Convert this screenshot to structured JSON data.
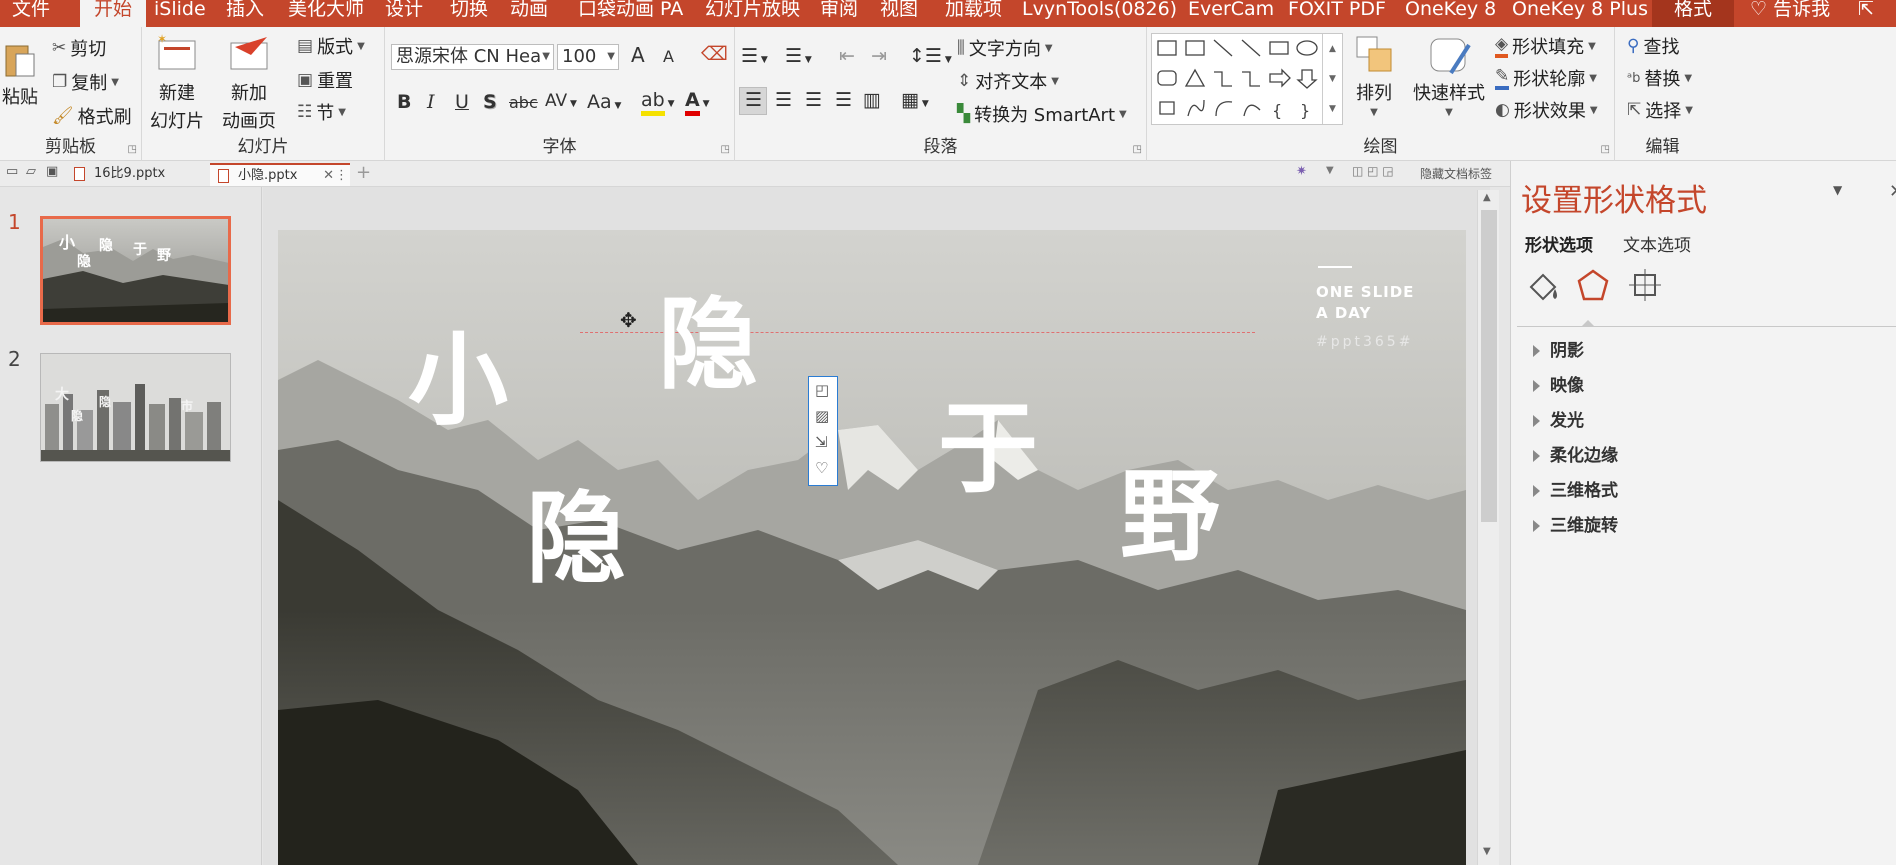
{
  "menu": {
    "tabs": [
      "文件",
      "开始",
      "iSlide",
      "插入",
      "美化大师",
      "设计",
      "切换",
      "动画",
      "口袋动画 PA",
      "幻灯片放映",
      "审阅",
      "视图",
      "加载项",
      "LvynTools(0826)",
      "EverCam",
      "FOXIT PDF",
      "OneKey 8",
      "OneKey 8 Plus",
      "格式",
      "告诉我"
    ],
    "active_tab": "开始"
  },
  "ribbon": {
    "clipboard": {
      "paste": "粘贴",
      "cut": "剪切",
      "copy": "复制",
      "format_painter": "格式刷",
      "label": "剪贴板"
    },
    "slides": {
      "new_slide_l1": "新建",
      "new_slide_l2": "幻灯片",
      "new_anim_l1": "新加",
      "new_anim_l2": "动画页",
      "layout": "版式",
      "reset": "重置",
      "section": "节",
      "label": "幻灯片"
    },
    "font": {
      "family": "思源宋体 CN Hea",
      "size": "100",
      "label": "字体",
      "bold": "B",
      "italic": "I",
      "underline": "U",
      "shadow": "S",
      "strike": "abc",
      "spacing": "AV",
      "case": "Aa",
      "grow": "A",
      "shrink": "A"
    },
    "paragraph": {
      "text_direction": "文字方向",
      "align_text": "对齐文本",
      "convert_smartart": "转换为 SmartArt",
      "label": "段落"
    },
    "drawing": {
      "arrange": "排列",
      "quick_styles": "快速样式",
      "shape_fill": "形状填充",
      "shape_outline": "形状轮廓",
      "shape_effects": "形状效果",
      "label": "绘图"
    },
    "editing": {
      "find": "查找",
      "replace": "替换",
      "select": "选择",
      "label": "编辑"
    }
  },
  "file_tabs": [
    {
      "name": "16比9.pptx",
      "active": false
    },
    {
      "name": "小隐.pptx",
      "active": true
    }
  ],
  "tabbar_right": "隐藏文档标签",
  "slides": [
    {
      "number": "1",
      "selected": true
    },
    {
      "number": "2",
      "selected": false
    }
  ],
  "slide": {
    "chars": {
      "c1": "小",
      "c2": "隐",
      "c3": "隐",
      "c4": "于",
      "c5": "野"
    },
    "header_line1": "ONE SLIDE",
    "header_line2": "A DAY",
    "hashtag": "#ppt365#"
  },
  "thumb1_chars": {
    "a": "小",
    "b": "隐",
    "c": "于",
    "d": "野",
    "e": "隐"
  },
  "thumb2_chars": {
    "a": "大",
    "b": "隐",
    "c": "市",
    "d": "隐"
  },
  "format_pane": {
    "title": "设置形状格式",
    "tabs": [
      "形状选项",
      "文本选项"
    ],
    "options": [
      "阴影",
      "映像",
      "发光",
      "柔化边缘",
      "三维格式",
      "三维旋转"
    ]
  },
  "colors": {
    "accent": "#c4462b",
    "guide": "#e07070"
  }
}
